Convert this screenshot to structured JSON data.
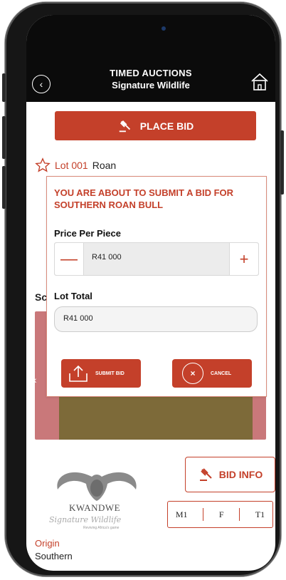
{
  "header": {
    "title_line1": "TIMED AUCTIONS",
    "title_line2": "Signature Wildlife",
    "back_icon": "chevron-left-circle-icon",
    "home_icon": "home-icon"
  },
  "place_bid": {
    "label": "PLACE BID",
    "icon": "gavel-icon"
  },
  "lot": {
    "number": "Lot 001",
    "name": "Roan",
    "star_icon": "star-outline-icon"
  },
  "background_fragments": {
    "sc_label": "Sc"
  },
  "modal": {
    "title": "YOU ARE ABOUT TO SUBMIT A BID FOR SOUTHERN ROAN BULL",
    "price_label": "Price Per Piece",
    "price_value": "R41 000",
    "minus_symbol": "—",
    "plus_symbol": "+",
    "total_label": "Lot Total",
    "total_value": "R41 000",
    "submit_label": "SUBMIT BID",
    "cancel_label": "CANCEL",
    "cancel_symbol": "×"
  },
  "gallery": {
    "prev_symbol": "‹",
    "next_symbol": "›"
  },
  "logo": {
    "brand": "KWANDWE",
    "script": "Signature Wildlife",
    "tagline": "Reviving Africa's game"
  },
  "bid_info": {
    "label": "BID INFO"
  },
  "tabs": [
    "M1",
    "F",
    "T1"
  ],
  "origin": {
    "label": "Origin",
    "value": "Southern"
  },
  "colors": {
    "accent": "#c4402a",
    "header_bg": "#0b0b0b",
    "gallery_frame": "#c9787a"
  }
}
